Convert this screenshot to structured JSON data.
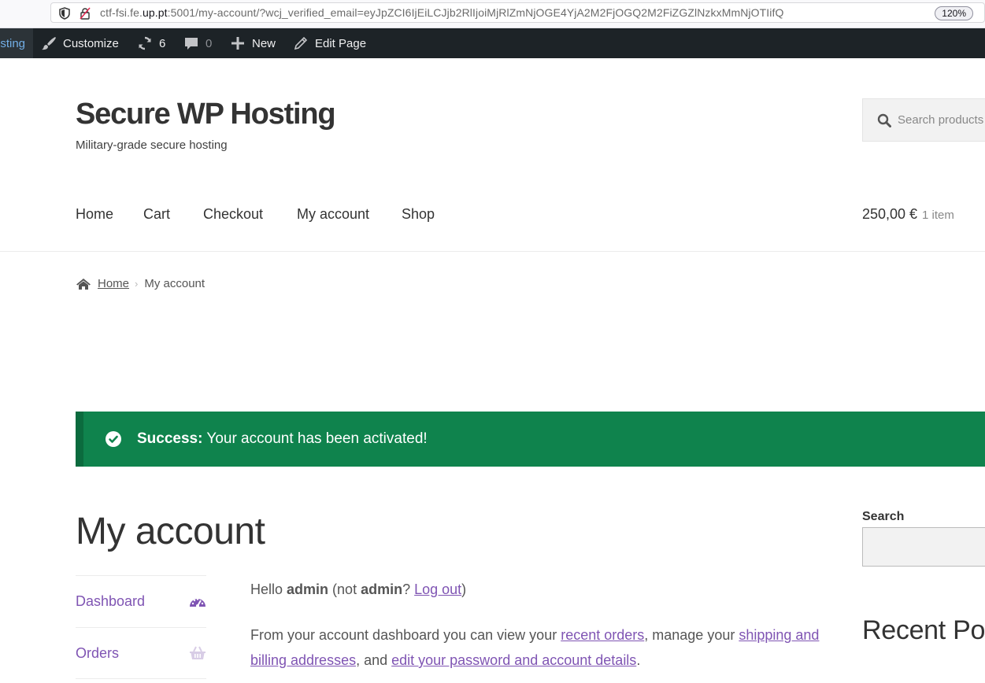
{
  "browser": {
    "url_pre": "ctf-fsi.fe.",
    "url_host": "up.pt",
    "url_post": ":5001/my-account/?wcj_verified_email=eyJpZCI6IjEiLCJjb2RlIjoiMjRlZmNjOGE4YjA2M2FjOGQ2M2FiZGZlNzkxMmNjOTIifQ",
    "zoom": "120%"
  },
  "adminbar": {
    "site_partial": "sting",
    "customize": "Customize",
    "updates_count": "6",
    "comments_count": "0",
    "new": "New",
    "edit_page": "Edit Page"
  },
  "site": {
    "title": "Secure WP Hosting",
    "description": "Military-grade secure hosting",
    "search_placeholder": "Search products"
  },
  "nav": {
    "items": [
      "Home",
      "Cart",
      "Checkout",
      "My account",
      "Shop"
    ]
  },
  "cart": {
    "total": "250,00 €",
    "count": "1 item"
  },
  "breadcrumb": {
    "home": "Home",
    "current": "My account"
  },
  "notice": {
    "strong": "Success:",
    "text": " Your account has been activated!"
  },
  "page": {
    "title": "My account"
  },
  "account_nav": {
    "items": [
      "Dashboard",
      "Orders"
    ]
  },
  "content": {
    "hello_pre": "Hello ",
    "user": "admin",
    "hello_mid": " (not ",
    "user2": "admin",
    "hello_q": "? ",
    "logout": "Log out",
    "hello_end": ")",
    "p2_a": "From your account dashboard you can view your ",
    "recent_orders": "recent orders",
    "p2_b": ", manage your ",
    "addresses": "shipping and billing addresses",
    "p2_c": ", and ",
    "account_details": "edit your password and account details",
    "p2_d": "."
  },
  "sidebar": {
    "search_title": "Search",
    "recent_posts": "Recent Posts"
  },
  "colors": {
    "success": "#0f834d",
    "link": "#7f54b3",
    "adminbar": "#1d2327"
  }
}
